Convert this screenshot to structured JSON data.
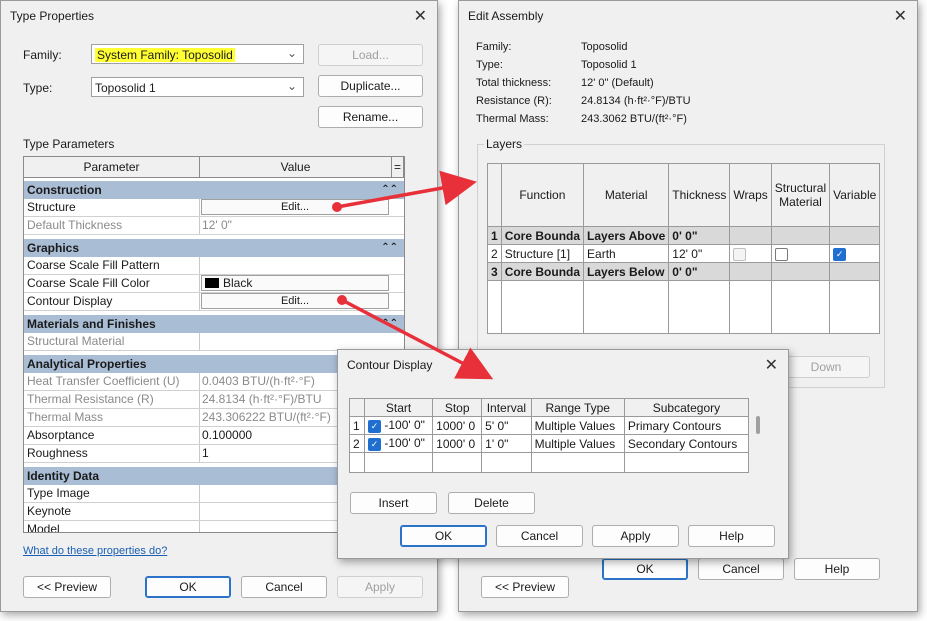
{
  "type_properties": {
    "title": "Type Properties",
    "family_label": "Family:",
    "family_value": "System Family: Toposolid",
    "type_label": "Type:",
    "type_value": "Toposolid 1",
    "load_button": "Load...",
    "duplicate_button": "Duplicate...",
    "rename_button": "Rename...",
    "section_label": "Type Parameters",
    "col_parameter": "Parameter",
    "col_value": "Value",
    "col_eq": "=",
    "groups": {
      "construction": "Construction",
      "graphics": "Graphics",
      "materials": "Materials and Finishes",
      "analytical": "Analytical Properties",
      "identity": "Identity Data"
    },
    "rows": {
      "structure": {
        "name": "Structure",
        "value": "Edit..."
      },
      "default_thickness": {
        "name": "Default Thickness",
        "value": "12'  0\""
      },
      "coarse_pattern": {
        "name": "Coarse Scale Fill Pattern",
        "value": ""
      },
      "coarse_color": {
        "name": "Coarse Scale Fill Color",
        "value": "Black"
      },
      "contour_display": {
        "name": "Contour Display",
        "value": "Edit..."
      },
      "structural_material": {
        "name": "Structural Material",
        "value": ""
      },
      "htc": {
        "name": "Heat Transfer Coefficient (U)",
        "value": "0.0403 BTU/(h·ft²·°F)"
      },
      "thermal_resistance": {
        "name": "Thermal Resistance (R)",
        "value": "24.8134 (h·ft²·°F)/BTU"
      },
      "thermal_mass": {
        "name": "Thermal Mass",
        "value": "243.306222 BTU/(ft²·°F)"
      },
      "absorptance": {
        "name": "Absorptance",
        "value": "0.100000"
      },
      "roughness": {
        "name": "Roughness",
        "value": "1"
      },
      "type_image": {
        "name": "Type Image",
        "value": ""
      },
      "keynote": {
        "name": "Keynote",
        "value": ""
      },
      "model": {
        "name": "Model",
        "value": ""
      }
    },
    "help_link": "What do these properties do?",
    "preview_button": "<< Preview",
    "ok_button": "OK",
    "cancel_button": "Cancel",
    "apply_button": "Apply"
  },
  "edit_assembly": {
    "title": "Edit Assembly",
    "family_label": "Family:",
    "family_value": "Toposolid",
    "type_label": "Type:",
    "type_value": "Toposolid 1",
    "thickness_label": "Total thickness:",
    "thickness_value": "12'  0\" (Default)",
    "resistance_label": "Resistance (R):",
    "resistance_value": "24.8134 (h·ft²·°F)/BTU",
    "mass_label": "Thermal Mass:",
    "mass_value": "243.3062 BTU/(ft²·°F)",
    "layers_label": "Layers",
    "columns": [
      "Function",
      "Material",
      "Thickness",
      "Wraps",
      "Structural Material",
      "Variable"
    ],
    "layers": [
      {
        "num": "1",
        "function": "Core Bounda",
        "material": "Layers Above",
        "thickness": "0'  0\""
      },
      {
        "num": "2",
        "function": "Structure [1]",
        "material": "Earth",
        "thickness": "12'  0\""
      },
      {
        "num": "3",
        "function": "Core Bounda",
        "material": "Layers Below",
        "thickness": "0'  0\""
      }
    ],
    "down_button": "Down",
    "preview_button": "<< Preview",
    "ok_button": "OK",
    "cancel_button": "Cancel",
    "help_button": "Help"
  },
  "contour_display": {
    "title": "Contour Display",
    "columns": [
      "Start",
      "Stop",
      "Interval",
      "Range Type",
      "Subcategory"
    ],
    "rows": [
      {
        "num": "1",
        "start": "-100'  0\"",
        "stop": "1000'  0",
        "interval": "5'  0\"",
        "range_type": "Multiple Values",
        "subcategory": "Primary Contours"
      },
      {
        "num": "2",
        "start": "-100'  0\"",
        "stop": "1000'  0",
        "interval": "1'  0\"",
        "range_type": "Multiple Values",
        "subcategory": "Secondary Contours"
      }
    ],
    "insert_button": "Insert",
    "delete_button": "Delete",
    "ok_button": "OK",
    "cancel_button": "Cancel",
    "apply_button": "Apply",
    "help_button": "Help"
  },
  "colors": {
    "highlight": "#ffff33",
    "group_header": "#a9bdd4",
    "arrow": "#e8303a",
    "checkbox_on": "#1f6fd0"
  }
}
